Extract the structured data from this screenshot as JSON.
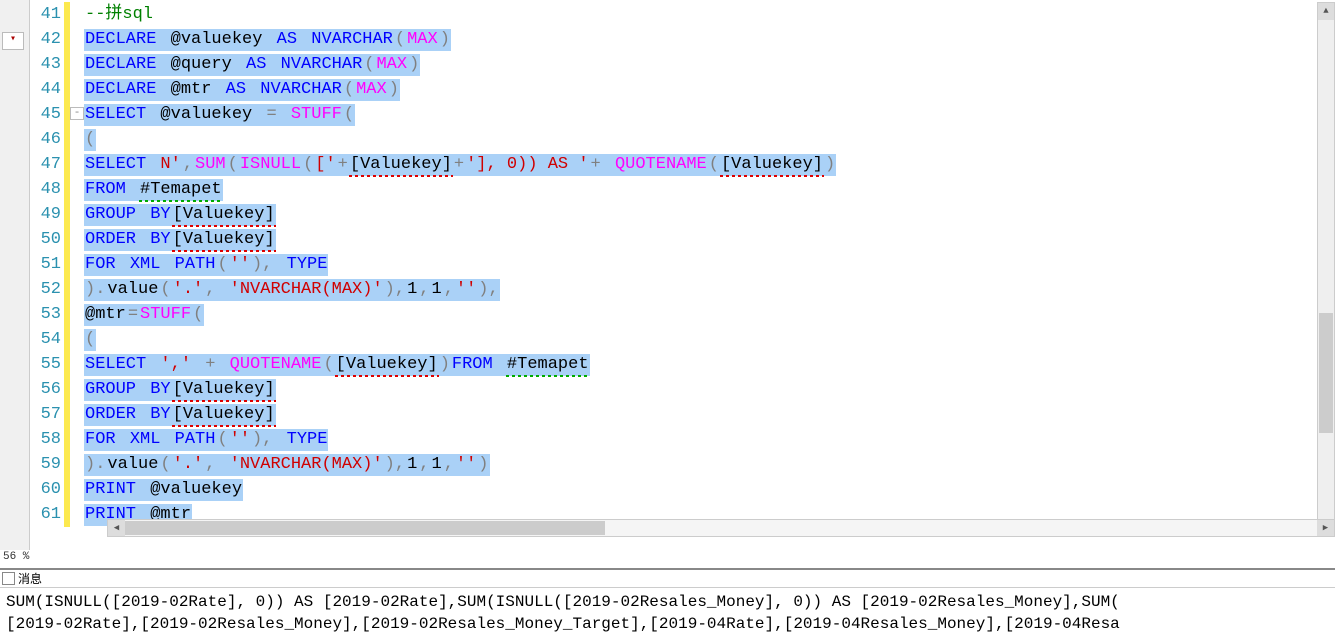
{
  "left_sidebar": {
    "dropdown_glyph": "▾"
  },
  "zoom": "56 %",
  "output": {
    "tab_label": "消息",
    "lines": [
      "SUM(ISNULL([2019-02Rate], 0)) AS [2019-02Rate],SUM(ISNULL([2019-02Resales_Money], 0)) AS [2019-02Resales_Money],SUM(",
      "[2019-02Rate],[2019-02Resales_Money],[2019-02Resales_Money_Target],[2019-04Rate],[2019-04Resales_Money],[2019-04Resa"
    ]
  },
  "rows": [
    {
      "n": "41",
      "fold": "",
      "sel": false,
      "plain": [
        [
          "c-cmt",
          "--拼sql"
        ]
      ]
    },
    {
      "n": "42",
      "fold": "",
      "sel": true,
      "tokens": [
        [
          "c-kw",
          "DECLARE"
        ],
        [
          "",
          ""
        ],
        [
          "c-var",
          "@valuekey"
        ],
        [
          "",
          ""
        ],
        [
          "c-kw",
          "AS"
        ],
        [
          "",
          ""
        ],
        [
          "c-kw",
          "NVARCHAR"
        ],
        [
          "c-gray",
          "("
        ],
        [
          "c-fn",
          "MAX"
        ],
        [
          "c-gray",
          ")"
        ]
      ]
    },
    {
      "n": "43",
      "fold": "",
      "sel": true,
      "tokens": [
        [
          "c-kw",
          "DECLARE"
        ],
        [
          "",
          ""
        ],
        [
          "c-var",
          "@query"
        ],
        [
          "",
          ""
        ],
        [
          "c-kw",
          "AS"
        ],
        [
          "",
          ""
        ],
        [
          "c-kw",
          "NVARCHAR"
        ],
        [
          "c-gray",
          "("
        ],
        [
          "c-fn",
          "MAX"
        ],
        [
          "c-gray",
          ")"
        ]
      ]
    },
    {
      "n": "44",
      "fold": "",
      "sel": true,
      "tokens": [
        [
          "c-kw",
          "DECLARE"
        ],
        [
          "",
          ""
        ],
        [
          "c-var",
          "@mtr"
        ],
        [
          "",
          ""
        ],
        [
          "c-kw",
          "AS"
        ],
        [
          "",
          ""
        ],
        [
          "c-kw",
          "NVARCHAR"
        ],
        [
          "c-gray",
          "("
        ],
        [
          "c-fn",
          "MAX"
        ],
        [
          "c-gray",
          ")"
        ]
      ]
    },
    {
      "n": "45",
      "fold": "⊟",
      "sel": true,
      "tokens": [
        [
          "c-kw",
          "SELECT"
        ],
        [
          "",
          ""
        ],
        [
          "c-var",
          "@valuekey"
        ],
        [
          "",
          ""
        ],
        [
          "c-gray",
          "="
        ],
        [
          "",
          ""
        ],
        [
          "c-fn",
          "STUFF"
        ],
        [
          "c-gray",
          "("
        ]
      ]
    },
    {
      "n": "46",
      "fold": "",
      "sel": true,
      "tokens": [
        [
          "c-gray",
          "("
        ]
      ]
    },
    {
      "n": "47",
      "fold": "",
      "sel": true,
      "tokens": [
        [
          "c-kw",
          "SELECT"
        ],
        [
          "",
          ""
        ],
        [
          "c-str",
          "N'"
        ],
        [
          "c-gray",
          ","
        ],
        [
          "c-fn",
          "SUM"
        ],
        [
          "c-gray",
          "("
        ],
        [
          "c-fn",
          "ISNULL"
        ],
        [
          "c-gray",
          "("
        ],
        [
          "c-str",
          "['"
        ],
        [
          "c-gray",
          "+"
        ],
        [
          "c-id sq",
          "[Valuekey]"
        ],
        [
          "c-gray",
          "+"
        ],
        [
          "c-str",
          "'], 0)) AS '"
        ],
        [
          "c-gray",
          "+"
        ],
        [
          "",
          ""
        ],
        [
          "c-fn",
          "QUOTENAME"
        ],
        [
          "c-gray",
          "("
        ],
        [
          "c-id sq",
          "[Valuekey]"
        ],
        [
          "c-gray",
          ")"
        ]
      ]
    },
    {
      "n": "48",
      "fold": "",
      "sel": true,
      "tokens": [
        [
          "c-kw",
          "FROM"
        ],
        [
          "",
          ""
        ],
        [
          "c-id sqg",
          "#Temapet"
        ]
      ]
    },
    {
      "n": "49",
      "fold": "",
      "sel": true,
      "tokens": [
        [
          "c-kw",
          "GROUP"
        ],
        [
          "",
          ""
        ],
        [
          "c-kw",
          "BY"
        ],
        [
          "c-id sq",
          "[Valuekey]"
        ]
      ]
    },
    {
      "n": "50",
      "fold": "",
      "sel": true,
      "tokens": [
        [
          "c-kw",
          "ORDER"
        ],
        [
          "",
          ""
        ],
        [
          "c-kw",
          "BY"
        ],
        [
          "c-id sq",
          "[Valuekey]"
        ]
      ]
    },
    {
      "n": "51",
      "fold": "",
      "sel": true,
      "tokens": [
        [
          "c-kw",
          "FOR"
        ],
        [
          "",
          ""
        ],
        [
          "c-kw",
          "XML"
        ],
        [
          "",
          ""
        ],
        [
          "c-kw",
          "PATH"
        ],
        [
          "c-gray",
          "("
        ],
        [
          "c-str",
          "''"
        ],
        [
          "c-gray",
          "),"
        ],
        [
          "",
          ""
        ],
        [
          "c-kw",
          "TYPE"
        ]
      ]
    },
    {
      "n": "52",
      "fold": "",
      "sel": true,
      "tokens": [
        [
          "c-gray",
          ")."
        ],
        [
          "c-var",
          "value"
        ],
        [
          "c-gray",
          "("
        ],
        [
          "c-str",
          "'.'"
        ],
        [
          "c-gray",
          ","
        ],
        [
          "",
          ""
        ],
        [
          "c-str",
          "'NVARCHAR(MAX)'"
        ],
        [
          "c-gray",
          "),"
        ],
        [
          "c-num",
          "1"
        ],
        [
          "c-gray",
          ","
        ],
        [
          "c-num",
          "1"
        ],
        [
          "c-gray",
          ","
        ],
        [
          "c-str",
          "''"
        ],
        [
          "c-gray",
          "),"
        ]
      ]
    },
    {
      "n": "53",
      "fold": "",
      "sel": true,
      "tokens": [
        [
          "c-var",
          "@mtr"
        ],
        [
          "c-gray",
          "="
        ],
        [
          "c-fn",
          "STUFF"
        ],
        [
          "c-gray",
          "("
        ]
      ]
    },
    {
      "n": "54",
      "fold": "",
      "sel": true,
      "tokens": [
        [
          "c-gray",
          "("
        ]
      ]
    },
    {
      "n": "55",
      "fold": "",
      "sel": true,
      "tokens": [
        [
          "c-kw",
          "SELECT"
        ],
        [
          "",
          ""
        ],
        [
          "c-str",
          "','"
        ],
        [
          "",
          ""
        ],
        [
          "c-gray",
          "+"
        ],
        [
          "",
          ""
        ],
        [
          "c-fn",
          "QUOTENAME"
        ],
        [
          "c-gray",
          "("
        ],
        [
          "c-id sq",
          "[Valuekey]"
        ],
        [
          "c-gray",
          ")"
        ],
        [
          "c-kw",
          "FROM"
        ],
        [
          "",
          ""
        ],
        [
          "c-id sqg",
          "#Temapet"
        ]
      ]
    },
    {
      "n": "56",
      "fold": "",
      "sel": true,
      "tokens": [
        [
          "c-kw",
          "GROUP"
        ],
        [
          "",
          ""
        ],
        [
          "c-kw",
          "BY"
        ],
        [
          "c-id sq",
          "[Valuekey]"
        ]
      ]
    },
    {
      "n": "57",
      "fold": "",
      "sel": true,
      "tokens": [
        [
          "c-kw",
          "ORDER"
        ],
        [
          "",
          ""
        ],
        [
          "c-kw",
          "BY"
        ],
        [
          "c-id sq",
          "[Valuekey]"
        ]
      ]
    },
    {
      "n": "58",
      "fold": "",
      "sel": true,
      "tokens": [
        [
          "c-kw",
          "FOR"
        ],
        [
          "",
          ""
        ],
        [
          "c-kw",
          "XML"
        ],
        [
          "",
          ""
        ],
        [
          "c-kw",
          "PATH"
        ],
        [
          "c-gray",
          "("
        ],
        [
          "c-str",
          "''"
        ],
        [
          "c-gray",
          "),"
        ],
        [
          "",
          ""
        ],
        [
          "c-kw",
          "TYPE"
        ]
      ]
    },
    {
      "n": "59",
      "fold": "",
      "sel": true,
      "tokens": [
        [
          "c-gray",
          ")."
        ],
        [
          "c-var",
          "value"
        ],
        [
          "c-gray",
          "("
        ],
        [
          "c-str",
          "'.'"
        ],
        [
          "c-gray",
          ","
        ],
        [
          "",
          ""
        ],
        [
          "c-str",
          "'NVARCHAR(MAX)'"
        ],
        [
          "c-gray",
          "),"
        ],
        [
          "c-num",
          "1"
        ],
        [
          "c-gray",
          ","
        ],
        [
          "c-num",
          "1"
        ],
        [
          "c-gray",
          ","
        ],
        [
          "c-str",
          "''"
        ],
        [
          "c-gray",
          ")"
        ]
      ]
    },
    {
      "n": "60",
      "fold": "",
      "sel": true,
      "tokens": [
        [
          "c-kw",
          "PRINT"
        ],
        [
          "",
          ""
        ],
        [
          "c-var",
          "@valuekey"
        ]
      ]
    },
    {
      "n": "61",
      "fold": "",
      "sel": true,
      "tokens": [
        [
          "c-kw",
          "PRINT"
        ],
        [
          "",
          ""
        ],
        [
          "c-var",
          "@mtr"
        ]
      ]
    }
  ]
}
